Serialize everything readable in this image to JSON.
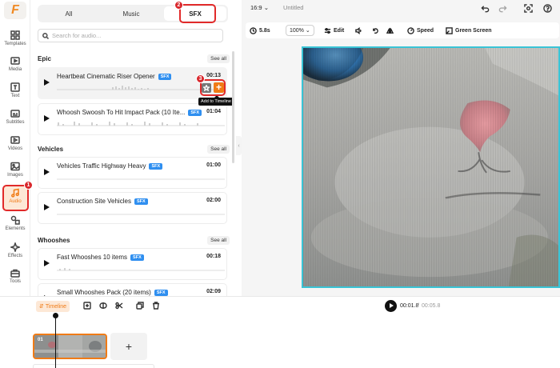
{
  "app": {
    "logo_letter": "F",
    "accent": "#f07b16",
    "annotation_color": "#e12a2a"
  },
  "rail": {
    "items": [
      {
        "label": "Templates",
        "icon": "templates-icon"
      },
      {
        "label": "Media",
        "icon": "media-icon"
      },
      {
        "label": "Text",
        "icon": "text-icon"
      },
      {
        "label": "Subtitles",
        "icon": "subtitles-icon"
      },
      {
        "label": "Videos",
        "icon": "videos-icon"
      },
      {
        "label": "Images",
        "icon": "images-icon"
      },
      {
        "label": "Audio",
        "icon": "music-note-icon",
        "active": true
      },
      {
        "label": "Elements",
        "icon": "elements-icon"
      },
      {
        "label": "Effects",
        "icon": "effects-icon"
      },
      {
        "label": "Tools",
        "icon": "tools-icon"
      }
    ]
  },
  "annotations": {
    "step1": "1",
    "step2": "2",
    "step3": "3"
  },
  "panel": {
    "tabs": [
      {
        "label": "All"
      },
      {
        "label": "Music"
      },
      {
        "label": "SFX",
        "active": true
      }
    ],
    "search_placeholder": "Search for audio...",
    "see_all_label": "See all",
    "sections": [
      {
        "title": "Epic",
        "items": [
          {
            "title": "Heartbeat Cinematic Riser Opener",
            "badge": "SFX",
            "duration": "00:13"
          },
          {
            "title": "Whoosh Swoosh To Hit Impact Pack (10 Ite...",
            "badge": "SFX",
            "duration": "01:04"
          }
        ]
      },
      {
        "title": "Vehicles",
        "items": [
          {
            "title": "Vehicles Traffic Highway Heavy",
            "badge": "SFX",
            "duration": "01:00"
          },
          {
            "title": "Construction Site Vehicles",
            "badge": "SFX",
            "duration": "02:00"
          }
        ]
      },
      {
        "title": "Whooshes",
        "items": [
          {
            "title": "Fast Whooshes 10 items",
            "badge": "SFX",
            "duration": "00:18"
          },
          {
            "title": "Small Whooshes Pack (20 items)",
            "badge": "SFX",
            "duration": "02:09"
          }
        ]
      }
    ],
    "add_button_label": "+",
    "tooltip": "Add to Timeline"
  },
  "editor": {
    "aspect_ratio": "16:9",
    "title": "Untitled",
    "toolbar": {
      "duration": "5.8s",
      "zoom": "100%",
      "edit": "Edit",
      "speed": "Speed",
      "green_screen": "Green Screen"
    }
  },
  "timeline": {
    "label": "Timeline",
    "current_time": "00:01.8",
    "separator": "/",
    "total_time": "00:05.8",
    "clip_number": "01",
    "add_clip_label": "+"
  }
}
